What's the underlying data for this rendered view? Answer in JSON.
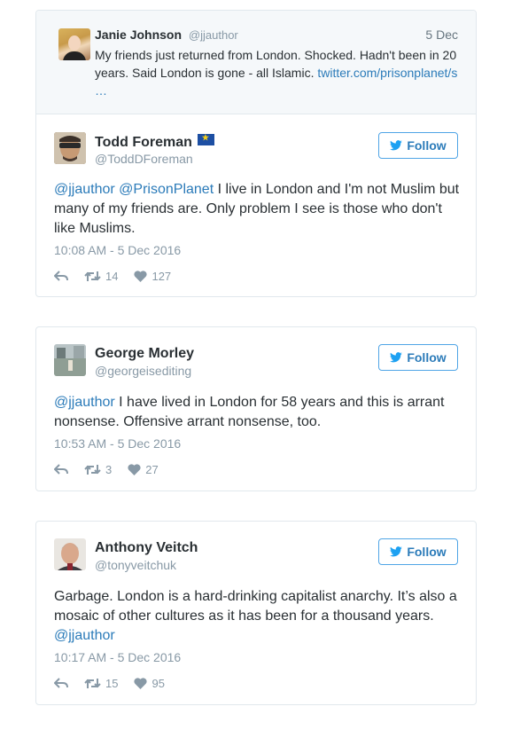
{
  "quoted": {
    "name": "Janie Johnson",
    "handle": "@jjauthor",
    "date": "5 Dec",
    "text": "My friends just returned from London. Shocked. Hadn't been in 20 years. Said London is gone - all Islamic. ",
    "link": "twitter.com/prisonplanet/s",
    "ellipsis": "…"
  },
  "follow_label": "Follow",
  "tweets": [
    {
      "name": "Todd Foreman",
      "handle": "@ToddDForeman",
      "mention1": "@jjauthor",
      "mention2": "@PrisonPlanet",
      "text": " I live in London and I'm not Muslim but many of my friends are. Only problem I see is those who don't like Muslims.",
      "time": "10:08 AM - 5 Dec 2016",
      "retweets": "14",
      "likes": "127"
    },
    {
      "name": "George Morley",
      "handle": "@georgeisediting",
      "mention1": "@jjauthor",
      "text": " I have lived in London for 58 years and this is arrant nonsense. Offensive arrant nonsense, too.",
      "time": "10:53 AM - 5 Dec 2016",
      "retweets": "3",
      "likes": "27"
    },
    {
      "name": "Anthony Veitch",
      "handle": "@tonyveitchuk",
      "text": "Garbage. London is a hard-drinking capitalist anarchy. It’s also a mosaic of other cultures as it has been for a thousand years.",
      "mention1": "@jjauthor",
      "time": "10:17 AM - 5 Dec 2016",
      "retweets": "15",
      "likes": "95"
    }
  ],
  "icons": {
    "reply": "reply-icon",
    "retweet": "retweet-icon",
    "like": "heart-icon",
    "follow": "twitter-bird-icon",
    "flag": "eu-flag-icon"
  },
  "colors": {
    "link": "#2b7bb9",
    "muted": "#8899a6",
    "border": "#e1e8ed",
    "follow_border": "#50a5e6",
    "quote_bg": "#f5f8fa"
  }
}
